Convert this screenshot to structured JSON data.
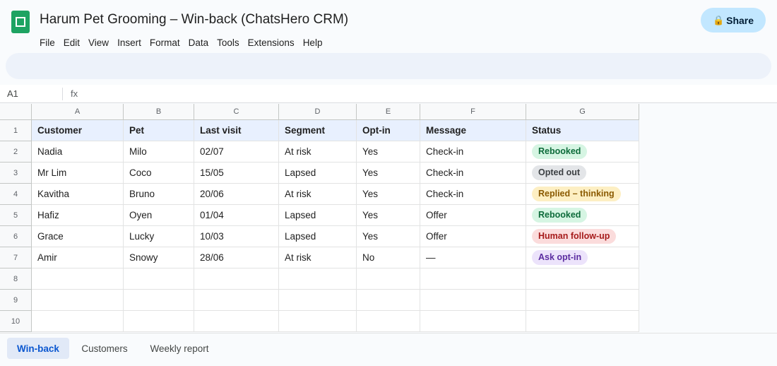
{
  "app": {
    "title": "Harum Pet Grooming – Win-back (ChatsHero CRM)",
    "share_label": "Share",
    "share_icon": "lock-icon"
  },
  "menu": [
    "File",
    "Edit",
    "View",
    "Insert",
    "Format",
    "Data",
    "Tools",
    "Extensions",
    "Help"
  ],
  "formula_bar": {
    "cell_ref": "A1",
    "fx_label": "fx",
    "content": ""
  },
  "columns": [
    "A",
    "B",
    "C",
    "D",
    "E",
    "F",
    "G"
  ],
  "row_numbers": [
    "1",
    "2",
    "3",
    "4",
    "5",
    "6",
    "7",
    "8",
    "9",
    "10"
  ],
  "table": {
    "headers": [
      "Customer",
      "Pet",
      "Last visit",
      "Segment",
      "Opt-in",
      "Message",
      "Status"
    ],
    "rows": [
      [
        "Nadia",
        "Milo",
        "02/07",
        "At risk",
        "Yes",
        "Check-in",
        "Rebooked"
      ],
      [
        "Mr Lim",
        "Coco",
        "15/05",
        "Lapsed",
        "Yes",
        "Check-in",
        "Opted out"
      ],
      [
        "Kavitha",
        "Bruno",
        "20/06",
        "At risk",
        "Yes",
        "Check-in",
        "Replied – thinking"
      ],
      [
        "Hafiz",
        "Oyen",
        "01/04",
        "Lapsed",
        "Yes",
        "Offer",
        "Rebooked"
      ],
      [
        "Grace",
        "Lucky",
        "10/03",
        "Lapsed",
        "Yes",
        "Offer",
        "Human follow-up"
      ],
      [
        "Amir",
        "Snowy",
        "28/06",
        "At risk",
        "No",
        "—",
        "Ask opt-in"
      ]
    ]
  },
  "status_colors": {
    "Rebooked": {
      "bg": "#d6f5e3",
      "fg": "#0d6b3a"
    },
    "Opted out": {
      "bg": "#e3e5e8",
      "fg": "#3c4043"
    },
    "Replied – thinking": {
      "bg": "#fdefc3",
      "fg": "#8a5a00"
    },
    "Human follow-up": {
      "bg": "#fbdcdc",
      "fg": "#a61b1b"
    },
    "Ask opt-in": {
      "bg": "#ece3fb",
      "fg": "#5b2ca0"
    }
  },
  "sheet_tabs": [
    {
      "label": "Win-back",
      "active": true
    },
    {
      "label": "Customers",
      "active": false
    },
    {
      "label": "Weekly report",
      "active": false
    }
  ],
  "colors": {
    "accent": "#0b57d0",
    "share_bg": "#c2e7ff",
    "logo": "#1ea362",
    "header_fill": "#e8f0fe"
  }
}
